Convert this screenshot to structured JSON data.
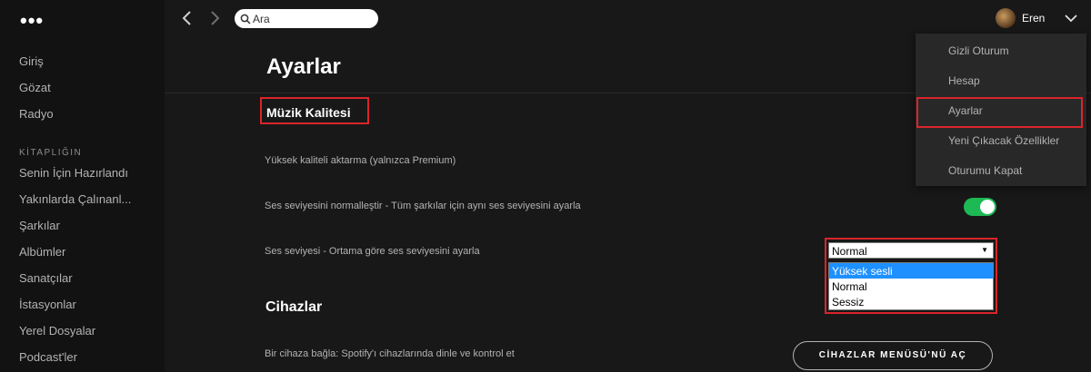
{
  "sidebar": {
    "menu_glyph": "•••",
    "nav": [
      "Giriş",
      "Gözat",
      "Radyo"
    ],
    "library_heading": "KİTAPLIĞIN",
    "library": [
      "Senin İçin Hazırlandı",
      "Yakınlarda Çalınanl...",
      "Şarkılar",
      "Albümler",
      "Sanatçılar",
      "İstasyonlar",
      "Yerel Dosyalar",
      "Podcast'ler"
    ]
  },
  "topbar": {
    "search_placeholder": "Ara",
    "username": "Eren"
  },
  "page": {
    "title": "Ayarlar",
    "music_section": "Müzik Kalitesi",
    "rows": [
      "Yüksek kaliteli aktarma (yalnızca Premium)",
      "Ses seviyesini normalleştir - Tüm şarkılar için aynı ses seviyesini ayarla",
      "Ses seviyesi - Ortama göre ses seviyesini ayarla"
    ],
    "normalize_toggle_on": true,
    "volume_select": {
      "selected": "Normal",
      "options": [
        "Yüksek sesli",
        "Normal",
        "Sessiz"
      ],
      "highlighted": "Yüksek sesli"
    },
    "devices_section": "Cihazlar",
    "devices_row": "Bir cihaza bağla: Spotify'ı cihazlarında dinle ve kontrol et",
    "devices_button": "CİHAZLAR MENÜSÜ'NÜ AÇ"
  },
  "user_menu": [
    "Gizli Oturum",
    "Hesap",
    "Ayarlar",
    "Yeni Çıkacak Özellikler",
    "Oturumu Kapat"
  ],
  "colors": {
    "accent_green": "#1db954",
    "highlight_red": "#d9252b",
    "background": "#181818",
    "sidebar": "#121212"
  }
}
